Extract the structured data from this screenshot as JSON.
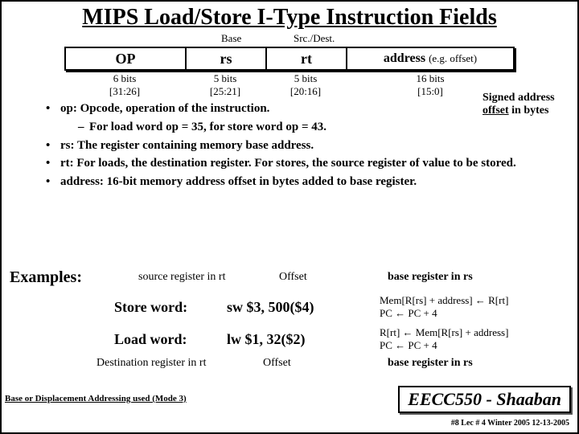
{
  "title": "MIPS Load/Store I-Type Instruction Fields",
  "diagram": {
    "top_base": "Base",
    "top_srcdest": "Src./Dest.",
    "fields": {
      "op": "OP",
      "rs": "rs",
      "rt": "rt",
      "address": "address",
      "address_eg": "(e.g. offset)"
    },
    "bits": {
      "op_bits": "6 bits",
      "op_range": "[31:26]",
      "rs_bits": "5 bits",
      "rs_range": "[25:21]",
      "rt_bits": "5 bits",
      "rt_range": "[20:16]",
      "addr_bits": "16 bits",
      "addr_range": "[15:0]"
    }
  },
  "signed_note_line1": "Signed address",
  "signed_note_line2a": "offset",
  "signed_note_line2b": " in bytes",
  "bullets": {
    "op": "op: Opcode, operation of the instruction.",
    "op_sub": "For load word op = 35,  for store word op = 43.",
    "rs": "rs: The register containing memory base address.",
    "rt": "rt: For loads, the destination register. For stores, the source register of value to be stored.",
    "address": "address:  16-bit memory address offset in bytes added to base register."
  },
  "examples": {
    "heading": "Examples:",
    "top_srcreg": "source register in rt",
    "top_offset": "Offset",
    "top_basereg": "base register in rs",
    "sw": {
      "label": "Store word:",
      "code": "sw $3, 500($4)",
      "sem1": "Mem[R[rs] + address] ← R[rt]",
      "sem2": "PC ← PC + 4"
    },
    "lw": {
      "label": "Load word:",
      "code": "lw $1, 32($2)",
      "sem1": "R[rt] ← Mem[R[rs] + address]",
      "sem2": "PC ← PC + 4"
    },
    "bot_destreg": "Destination register in rt",
    "bot_offset": "Offset",
    "bot_basereg": "base register in rs"
  },
  "footer": {
    "mode": "Base or Displacement Addressing used (Mode 3)",
    "course": "EECC550 - Shaaban",
    "meta": "#8   Lec # 4   Winter 2005   12-13-2005"
  }
}
